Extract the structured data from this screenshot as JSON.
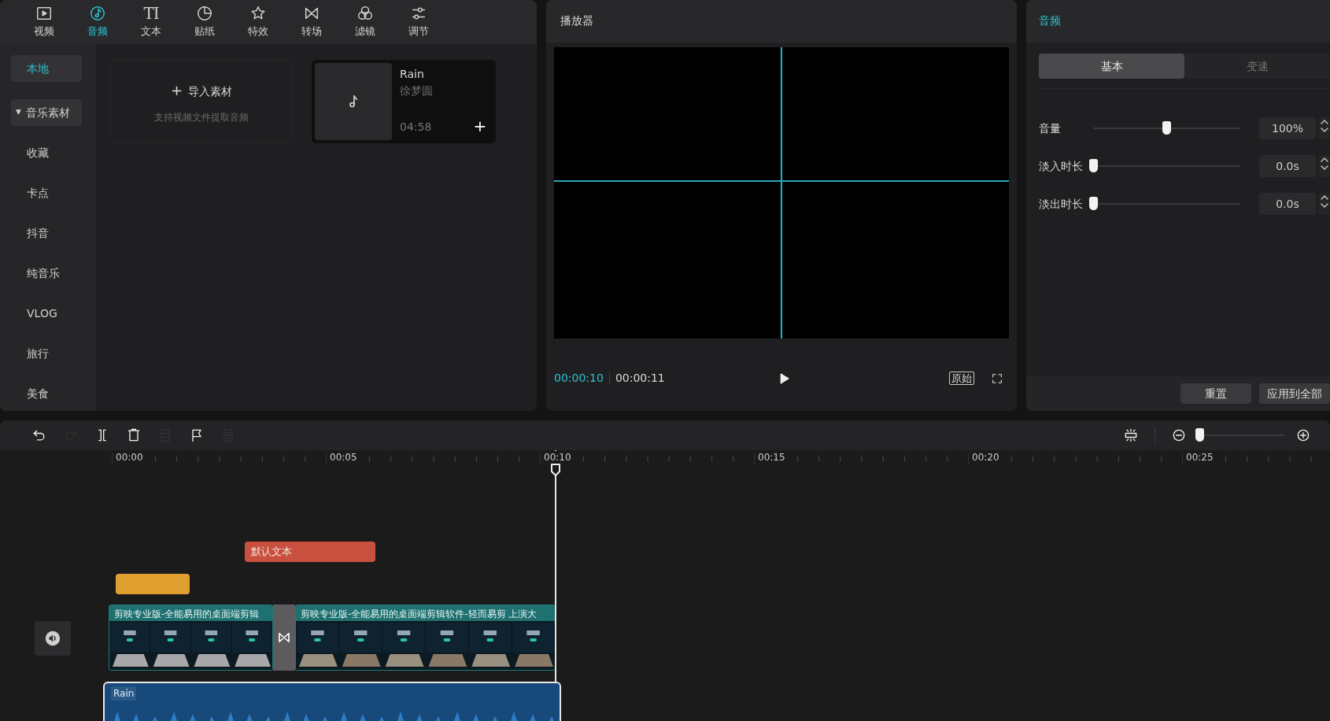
{
  "top_tabs": [
    {
      "kind": "video",
      "label": "视频",
      "selected": false
    },
    {
      "kind": "audio",
      "label": "音频",
      "selected": true
    },
    {
      "kind": "text",
      "label": "文本",
      "icon_text": "TI",
      "selected": false
    },
    {
      "kind": "sticker",
      "label": "贴纸",
      "selected": false
    },
    {
      "kind": "effect",
      "label": "特效",
      "selected": false
    },
    {
      "kind": "transition",
      "label": "转场",
      "selected": false
    },
    {
      "kind": "filter",
      "label": "滤镜",
      "selected": false
    },
    {
      "kind": "adjust",
      "label": "调节",
      "selected": false
    }
  ],
  "sidebar": [
    {
      "kind": "item",
      "label": "本地",
      "selected": true
    },
    {
      "kind": "group",
      "label": "音乐素材",
      "caret": "▼",
      "selected": false,
      "expanded": true
    },
    {
      "kind": "item",
      "label": "收藏",
      "selected": false
    },
    {
      "kind": "item",
      "label": "卡点",
      "selected": false
    },
    {
      "kind": "item",
      "label": "抖音",
      "selected": false
    },
    {
      "kind": "item",
      "label": "纯音乐",
      "selected": false
    },
    {
      "kind": "item",
      "label": "VLOG",
      "selected": false
    },
    {
      "kind": "item",
      "label": "旅行",
      "selected": false
    },
    {
      "kind": "item",
      "label": "美食",
      "selected": false
    }
  ],
  "import_card": {
    "label": "导入素材",
    "plus": "+",
    "hint": "支持视频文件提取音频"
  },
  "media": [
    {
      "title": "Rain",
      "artist": "徐梦圆",
      "duration": "04:58",
      "add": "+"
    }
  ],
  "player": {
    "title": "播放器",
    "current_time": "00:00:10",
    "total_time": "00:00:11",
    "ratio_button": "原始"
  },
  "audio_panel": {
    "title": "音频",
    "tabs": [
      {
        "label": "基本",
        "selected": true
      },
      {
        "label": "变速",
        "selected": false
      }
    ],
    "sliders": [
      {
        "label": "音量",
        "level": 0.5,
        "value": "100%"
      },
      {
        "label": "淡入时长",
        "level": 0,
        "value": "0.0s"
      },
      {
        "label": "淡出时长",
        "level": 0,
        "value": "0.0s"
      }
    ],
    "buttons": [
      "重置",
      "应用到全部"
    ]
  },
  "timeline": {
    "tools": [
      {
        "kind": "undo",
        "disabled": false
      },
      {
        "kind": "redo",
        "disabled": true
      },
      {
        "kind": "split",
        "disabled": false
      },
      {
        "kind": "delete",
        "disabled": false
      },
      {
        "kind": "freeze",
        "disabled": true
      },
      {
        "kind": "marker",
        "disabled": false
      },
      {
        "kind": "reverse",
        "disabled": true
      }
    ],
    "zoom": {
      "level": 0.02
    },
    "ruler": [
      "00:00",
      "00:05",
      "00:10",
      "00:15",
      "00:20",
      "00:25"
    ],
    "text_clip": {
      "label": "默认文本",
      "color": "#c9503f"
    },
    "effect_clip": {
      "color": "#e0a030"
    },
    "video_clips": [
      {
        "title": "剪映专业版-全能易用的桌面端剪辑"
      },
      {
        "title": "剪映专业版-全能易用的桌面端剪辑软件-轻而易剪 上演大"
      }
    ],
    "audio_clip": {
      "title": "Rain"
    }
  }
}
